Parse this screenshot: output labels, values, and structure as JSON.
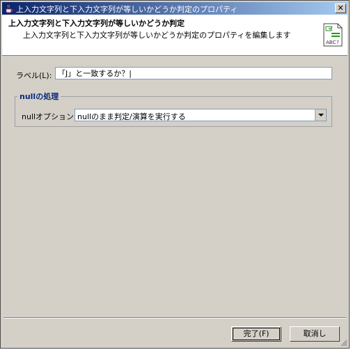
{
  "window": {
    "title": "上入力文字列と下入力文字列が等しいかどうか判定のプロパティ"
  },
  "header": {
    "title": "上入力文字列と下入力文字列が等しいかどうか判定",
    "description": "上入力文字列と下入力文字列が等しいかどうか判定のプロパティを編集します"
  },
  "label_field": {
    "label": "ラベル(L):",
    "value": "「J」と一致するか？|"
  },
  "null_group": {
    "title": "nullの処理",
    "option_label": "nullオプション:",
    "option_value": "nullのまま判定/演算を実行する"
  },
  "buttons": {
    "ok": "完了(F)",
    "cancel": "取消し"
  },
  "icons": {
    "app": "java-cup-icon",
    "header": "text-compare-icon",
    "close": "close-icon",
    "dropdown": "chevron-down-icon"
  },
  "colors": {
    "titlebar_start": "#0a246a",
    "titlebar_end": "#a6caf0",
    "group_title": "#0a2a7a",
    "dialog_bg": "#d4d0c8"
  }
}
